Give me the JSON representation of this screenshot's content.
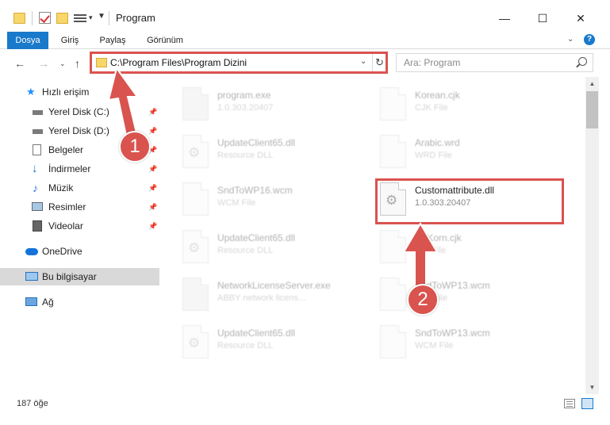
{
  "window": {
    "title": "Program",
    "minimize": "—",
    "maximize": "☐",
    "close": "✕"
  },
  "ribbon": {
    "tabs": [
      "Dosya",
      "Giriş",
      "Paylaş",
      "Görünüm"
    ],
    "help": "?"
  },
  "address": {
    "path": "C:\\Program Files\\Program Dizini"
  },
  "search": {
    "placeholder": "Ara: Program"
  },
  "sidebar": {
    "items": [
      {
        "label": "Hızlı erişim"
      },
      {
        "label": "Yerel Disk (C:)"
      },
      {
        "label": "Yerel Disk (D:)"
      },
      {
        "label": "Belgeler"
      },
      {
        "label": "İndirmeler"
      },
      {
        "label": "Müzik"
      },
      {
        "label": "Resimler"
      },
      {
        "label": "Videolar"
      },
      {
        "label": "OneDrive"
      },
      {
        "label": "Bu bilgisayar"
      },
      {
        "label": "Ağ"
      }
    ]
  },
  "files": [
    {
      "name": "program.exe",
      "sub": "1.0.303.20407"
    },
    {
      "name": "Korean.cjk",
      "sub": "CJK File"
    },
    {
      "name": "UpdateClient65.dll",
      "sub": "Resource DLL"
    },
    {
      "name": "Arabic.wrd",
      "sub": "WRD File"
    },
    {
      "name": "SndToWP16.wcm",
      "sub": "WCM File"
    },
    {
      "name": "Customattribute.dll",
      "sub": "1.0.303.20407"
    },
    {
      "name": "UpdateClient65.dll",
      "sub": "Resource DLL"
    },
    {
      "name": "…tKorn.cjk",
      "sub": "…K File"
    },
    {
      "name": "NetworkLicenseServer.exe",
      "sub": "ABBY network licens…"
    },
    {
      "name": "SndToWP13.wcm",
      "sub": "…M File"
    },
    {
      "name": "UpdateClient65.dll",
      "sub": "Resource DLL"
    },
    {
      "name": "SndToWP13.wcm",
      "sub": "WCM File"
    }
  ],
  "status": {
    "count": "187 öğe"
  },
  "annotations": {
    "step1": "1",
    "step2": "2",
    "color": "#d9534f"
  }
}
